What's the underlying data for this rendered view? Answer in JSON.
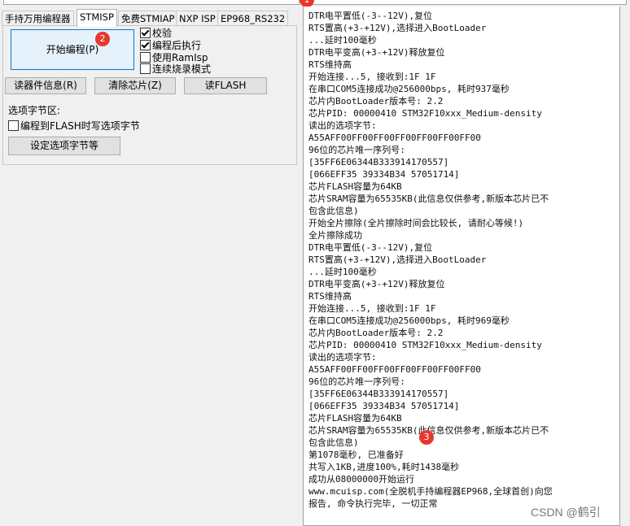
{
  "tabs": [
    "手持万用编程器",
    "STMISP",
    "免费STMIAP",
    "NXP ISP",
    "EP968_RS232"
  ],
  "active_tab": "STMISP",
  "buttons": {
    "start_program": "开始编程(P)",
    "read_info": "读器件信息(R)",
    "erase_chip": "清除芯片(Z)",
    "read_flash": "读FLASH",
    "set_option_bytes": "设定选项字节等"
  },
  "checkboxes": [
    {
      "label": "校验",
      "checked": true
    },
    {
      "label": "编程后执行",
      "checked": true
    },
    {
      "label": "使用RamIsp",
      "checked": false
    },
    {
      "label": "连续烧录模式",
      "checked": false
    }
  ],
  "option_area": {
    "title": "选项字节区:",
    "write_option_label": "编程到FLASH时写选项字节",
    "write_option_checked": false
  },
  "annotations": {
    "a1": "1",
    "a2": "2",
    "a3": "3"
  },
  "log_lines": [
    "DTR电平置低(-3--12V),复位",
    "RTS置高(+3-+12V),选择进入BootLoader",
    "...延时100毫秒",
    "DTR电平变高(+3-+12V)释放复位",
    "RTS维持高",
    "开始连接...5, 接收到:1F 1F",
    "在串口COM5连接成功@256000bps, 耗时937毫秒",
    "芯片内BootLoader版本号: 2.2",
    "芯片PID: 00000410  STM32F10xxx_Medium-density",
    "读出的选项字节:",
    "A55AFF00FF00FF00FF00FF00FF00FF00",
    "96位的芯片唯一序列号:",
    "[35FF6E06344B333914170557]",
    "[066EFF35 39334B34 57051714]",
    "芯片FLASH容量为64KB",
    "芯片SRAM容量为65535KB(此信息仅供参考,新版本芯片已不",
    "包含此信息)",
    "开始全片擦除(全片擦除时间会比较长, 请耐心等候!)",
    "全片擦除成功",
    "DTR电平置低(-3--12V),复位",
    "RTS置高(+3-+12V),选择进入BootLoader",
    "...延时100毫秒",
    "DTR电平变高(+3-+12V)释放复位",
    "RTS维持高",
    "开始连接...5, 接收到:1F 1F",
    "在串口COM5连接成功@256000bps, 耗时969毫秒",
    "芯片内BootLoader版本号: 2.2",
    "芯片PID: 00000410  STM32F10xxx_Medium-density",
    "读出的选项字节:",
    "A55AFF00FF00FF00FF00FF00FF00FF00",
    "96位的芯片唯一序列号:",
    "[35FF6E06344B333914170557]",
    "[066EFF35 39334B34 57051714]",
    "芯片FLASH容量为64KB",
    "芯片SRAM容量为65535KB(此信息仅供参考,新版本芯片已不",
    "包含此信息)",
    "第1078毫秒, 已准备好",
    "共写入1KB,进度100%,耗时1438毫秒",
    "成功从08000000开始运行",
    "www.mcuisp.com(全脱机手持编程器EP968,全球首创)向您",
    "报告, 命令执行完毕, 一切正常"
  ],
  "watermark": "CSDN @鹤引"
}
